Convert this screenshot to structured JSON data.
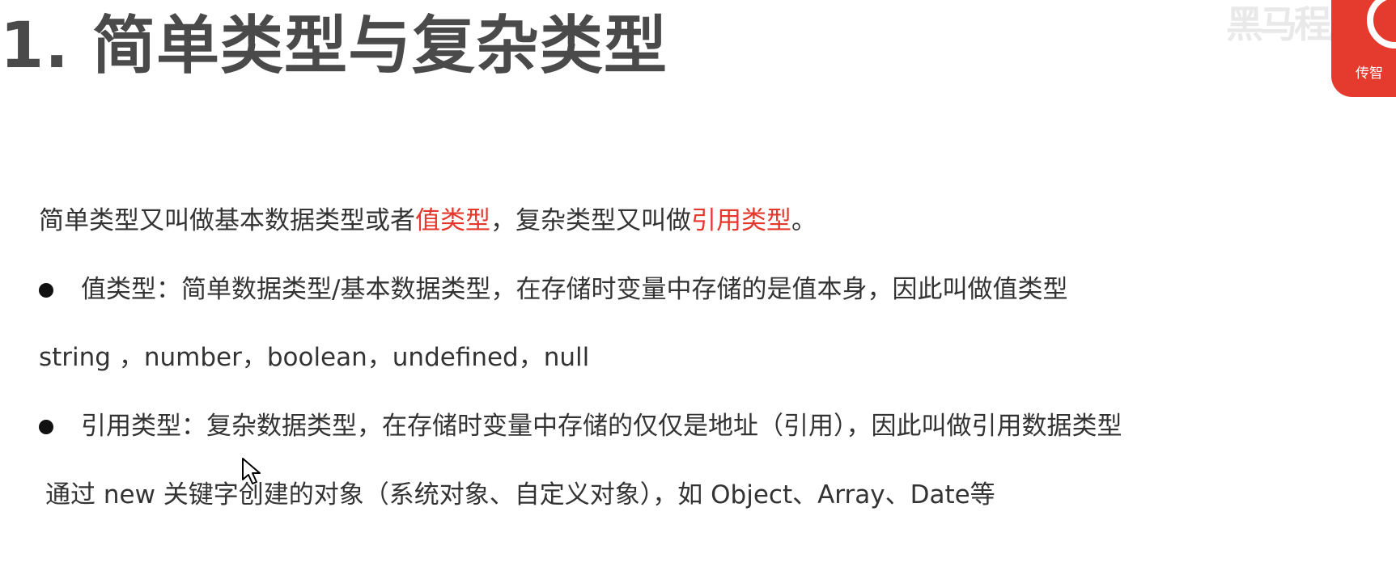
{
  "title": "1. 简单类型与复杂类型",
  "intro": {
    "part1": "简单类型又叫做基本数据类型或者",
    "highlight1": "值类型",
    "part2": "，复杂类型又叫做",
    "highlight2": "引用类型",
    "part3": "。"
  },
  "bullets": [
    {
      "text": "值类型：简单数据类型/基本数据类型，在存储时变量中存储的是值本身，因此叫做值类型"
    },
    {
      "text": "引用类型：复杂数据类型，在存储时变量中存储的仅仅是地址（引用），因此叫做引用数据类型"
    }
  ],
  "value_types_line": "string ，number，boolean，undefined，null",
  "reference_types_line": "通过 new 关键字创建的对象（系统对象、自定义对象），如 Object、Array、Date等",
  "logo": {
    "caption": "传智",
    "watermark": "黑马程序"
  },
  "colors": {
    "title": "#4a4a4a",
    "body": "#333333",
    "highlight": "#e5372c",
    "logo_bg": "#e53a2e"
  }
}
